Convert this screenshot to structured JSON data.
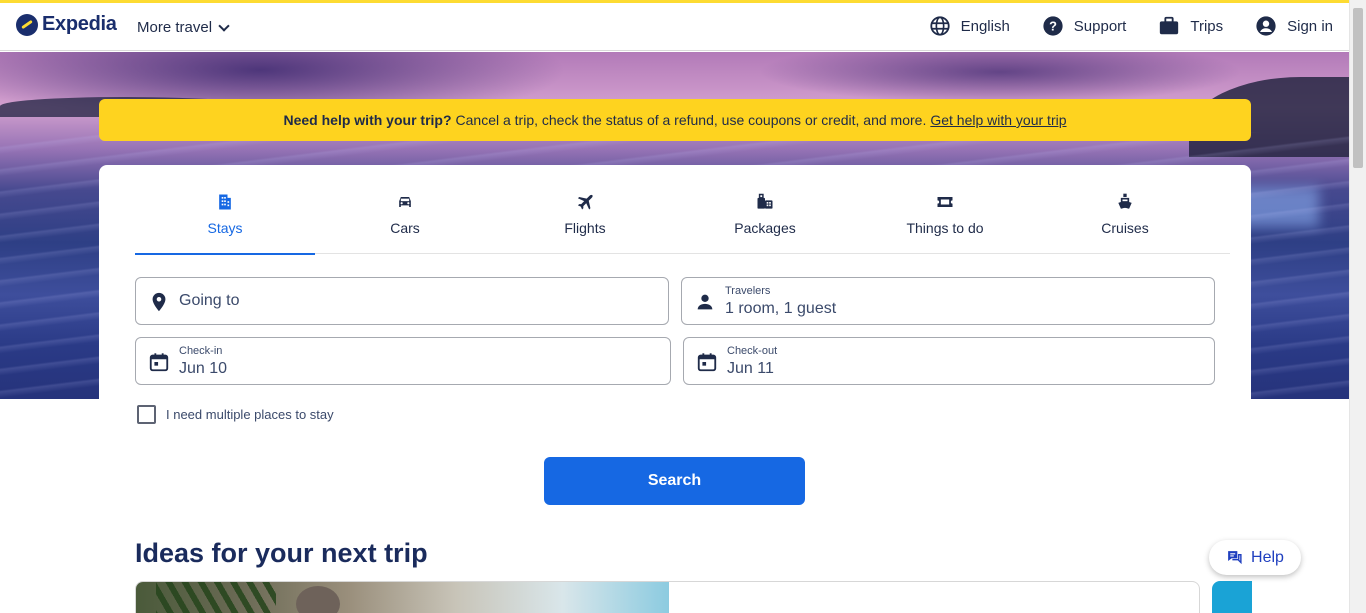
{
  "header": {
    "logo_text": "Expedia",
    "more_travel": "More travel",
    "nav": {
      "language": "English",
      "support": "Support",
      "trips": "Trips",
      "sign_in": "Sign in"
    }
  },
  "banner": {
    "bold": "Need help with your trip?",
    "text": "Cancel a trip, check the status of a refund, use coupons or credit, and more.",
    "link": "Get help with your trip"
  },
  "tabs": [
    {
      "label": "Stays",
      "icon": "building-icon",
      "active": true
    },
    {
      "label": "Cars",
      "icon": "car-icon",
      "active": false
    },
    {
      "label": "Flights",
      "icon": "plane-icon",
      "active": false
    },
    {
      "label": "Packages",
      "icon": "packages-icon",
      "active": false
    },
    {
      "label": "Things to do",
      "icon": "ticket-icon",
      "active": false
    },
    {
      "label": "Cruises",
      "icon": "cruise-icon",
      "active": false
    }
  ],
  "form": {
    "going_to": {
      "placeholder": "Going to"
    },
    "travelers": {
      "label": "Travelers",
      "value": "1 room, 1 guest"
    },
    "checkin": {
      "label": "Check-in",
      "value": "Jun 10"
    },
    "checkout": {
      "label": "Check-out",
      "value": "Jun 11"
    },
    "multiple_places": "I need multiple places to stay",
    "search_label": "Search"
  },
  "ideas": {
    "title": "Ideas for your next trip"
  },
  "help_button": "Help",
  "colors": {
    "brand_blue": "#1668e3",
    "brand_yellow": "#fed31f",
    "navy": "#1a2e6d"
  }
}
